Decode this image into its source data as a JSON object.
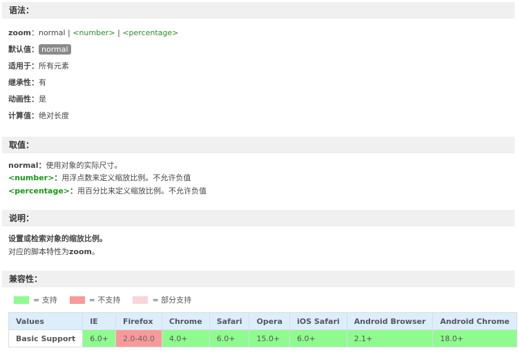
{
  "sections": {
    "syntax": {
      "title": "语法："
    },
    "values": {
      "title": "取值："
    },
    "description": {
      "title": "说明："
    },
    "compat": {
      "title": "兼容性："
    }
  },
  "syntax": {
    "prop_label": "zoom",
    "sep": "：",
    "normal": "normal",
    "pipe1": " | ",
    "number": "<number>",
    "pipe2": " | ",
    "percentage": "<percentage>",
    "default_label": "默认值",
    "default_value": "normal",
    "applies_label": "适用于",
    "applies_value": "所有元素",
    "inherited_label": "继承性",
    "inherited_value": "有",
    "animatable_label": "动画性",
    "animatable_value": "是",
    "computed_label": "计算值",
    "computed_value": "绝对长度"
  },
  "values": [
    {
      "key": "normal",
      "desc": "使用对象的实际尺寸。"
    },
    {
      "key": "<number>",
      "desc": "用浮点数来定义缩放比例。不允许负值"
    },
    {
      "key": "<percentage>",
      "desc": "用百分比来定义缩放比例。不允许负值"
    }
  ],
  "description": {
    "line1": "设置或检索对象的缩放比例。",
    "line2_prefix": "对应的脚本特性为",
    "line2_bold": "zoom",
    "line2_suffix": "。"
  },
  "legend": [
    {
      "label": "= 支持",
      "color": "#8ffb8f"
    },
    {
      "label": "= 不支持",
      "color": "#f89a9a"
    },
    {
      "label": "= 部分支持",
      "color": "#fad4d8"
    }
  ],
  "table": {
    "headers": [
      "Values",
      "IE",
      "Firefox",
      "Chrome",
      "Safari",
      "Opera",
      "iOS Safari",
      "Android Browser",
      "Android Chrome"
    ],
    "rows": [
      {
        "name": "Basic Support",
        "cells": [
          "6.0+",
          "2.0-40.0",
          "4.0+",
          "6.0+",
          "15.0+",
          "6.0+",
          "2.1+",
          "18.0+"
        ],
        "status": [
          "yes",
          "no",
          "yes",
          "yes",
          "yes",
          "yes",
          "yes",
          "yes"
        ]
      }
    ]
  }
}
